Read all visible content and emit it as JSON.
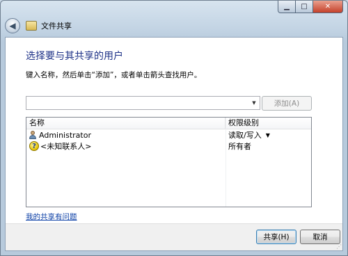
{
  "window": {
    "title": "文件共享",
    "minimize_icon": "minimize-icon",
    "maximize_icon": "maximize-icon",
    "close_icon": "close-icon"
  },
  "main": {
    "heading": "选择要与其共享的用户",
    "instructions": "键入名称，然后单击“添加”，或者单击箭头查找用户。",
    "name_input": {
      "value": "",
      "placeholder": ""
    },
    "add_button": "添加(A)"
  },
  "list": {
    "columns": [
      "名称",
      "权限级别"
    ],
    "rows": [
      {
        "icon": "user-icon",
        "name": "Administrator",
        "permission": "读取/写入",
        "has_dropdown": true
      },
      {
        "icon": "unknown-contact-icon",
        "name": "<未知联系人>",
        "permission": "所有者",
        "has_dropdown": false
      }
    ]
  },
  "help_link": "我的共享有问题",
  "footer": {
    "share_button": "共享(H)",
    "cancel_button": "取消"
  }
}
